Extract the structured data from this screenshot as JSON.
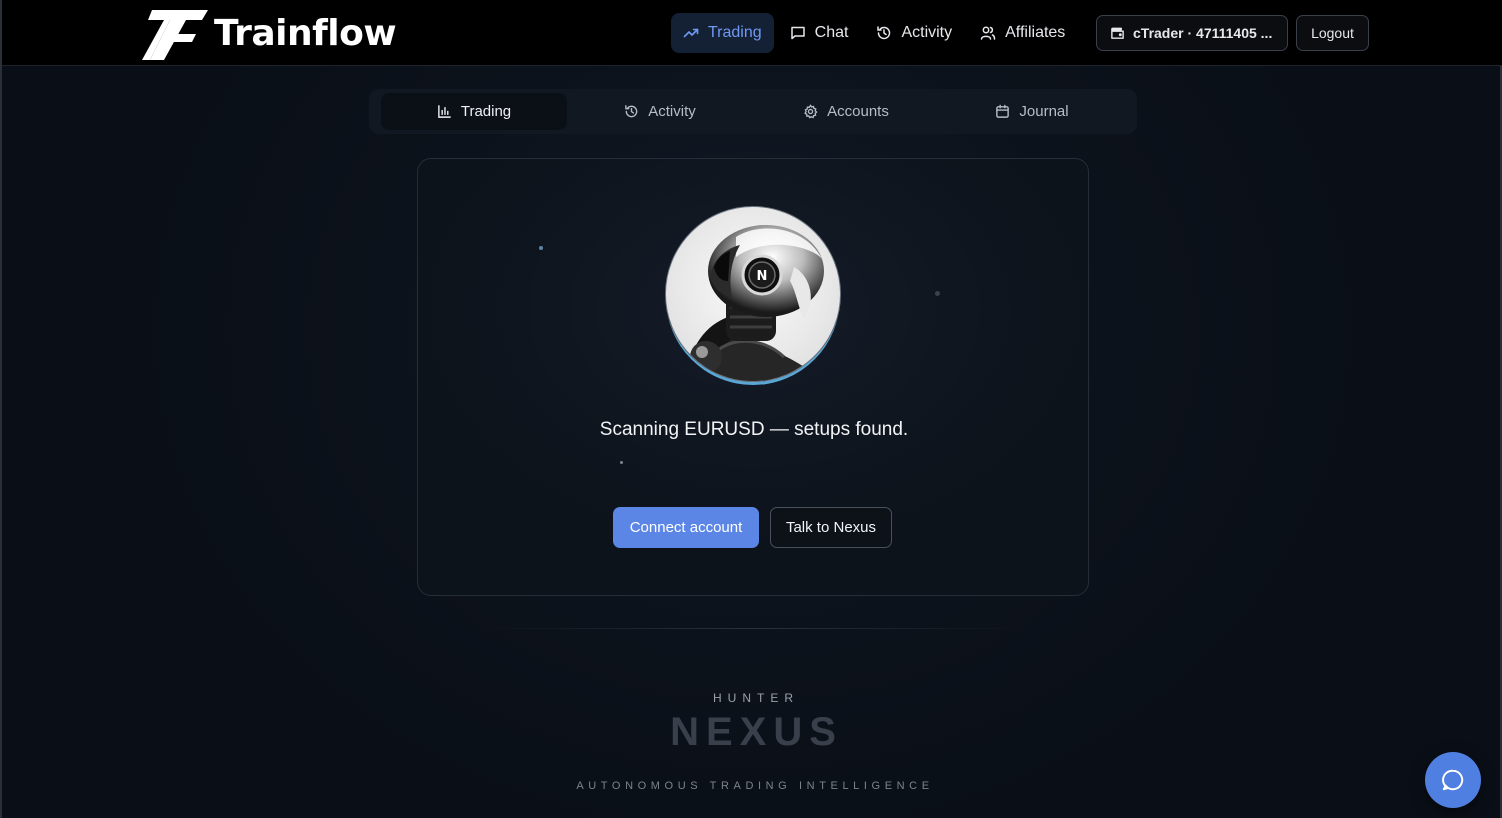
{
  "brand": {
    "name": "Trainflow"
  },
  "topnav": {
    "items": [
      {
        "label": "Trading",
        "icon": "trending-up-icon",
        "active": true
      },
      {
        "label": "Chat",
        "icon": "message-square-icon",
        "active": false
      },
      {
        "label": "Activity",
        "icon": "history-icon",
        "active": false
      },
      {
        "label": "Affiliates",
        "icon": "users-icon",
        "active": false
      }
    ],
    "account_label": "cTrader · 47111405 ...",
    "logout_label": "Logout"
  },
  "subtabs": [
    {
      "label": "Trading",
      "icon": "bar-chart-icon",
      "active": true
    },
    {
      "label": "Activity",
      "icon": "history-icon",
      "active": false
    },
    {
      "label": "Accounts",
      "icon": "gear-icon",
      "active": false
    },
    {
      "label": "Journal",
      "icon": "calendar-icon",
      "active": false
    }
  ],
  "card": {
    "avatar_badge": "N",
    "status": "Scanning EURUSD — setups found.",
    "primary_button": "Connect account",
    "secondary_button": "Talk to Nexus"
  },
  "footer": {
    "overline": "HUNTER",
    "title": "NEXUS",
    "tagline": "AUTONOMOUS TRADING INTELLIGENCE"
  },
  "colors": {
    "accent": "#5b86e6",
    "active_nav_text": "#6f99f2",
    "background": "#0b1119"
  }
}
